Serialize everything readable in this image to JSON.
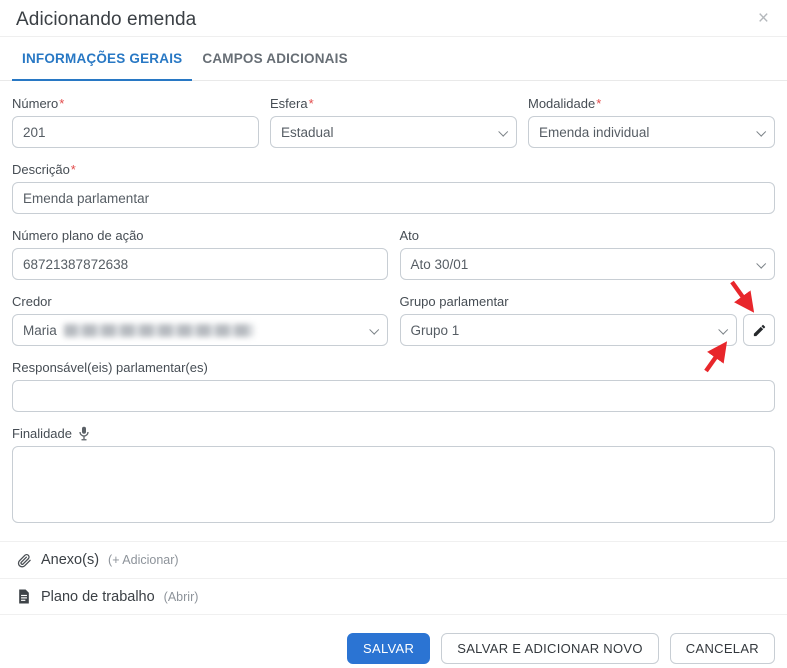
{
  "modal": {
    "title": "Adicionando emenda",
    "close_icon": "×"
  },
  "tabs": [
    {
      "label": "INFORMAÇÕES GERAIS",
      "active": true
    },
    {
      "label": "CAMPOS ADICIONAIS",
      "active": false
    }
  ],
  "form": {
    "required_mark": "*",
    "numero": {
      "label": "Número",
      "required": true,
      "value": "201"
    },
    "esfera": {
      "label": "Esfera",
      "required": true,
      "value": "Estadual"
    },
    "modalidade": {
      "label": "Modalidade",
      "required": true,
      "value": "Emenda individual"
    },
    "descricao": {
      "label": "Descrição",
      "required": true,
      "value": "Emenda parlamentar"
    },
    "numero_plano_acao": {
      "label": "Número plano de ação",
      "value": "68721387872638"
    },
    "ato": {
      "label": "Ato",
      "value": "Ato 30/01"
    },
    "credor": {
      "label": "Credor",
      "value": "Maria",
      "redacted": true
    },
    "grupo_parlamentar": {
      "label": "Grupo parlamentar",
      "value": "Grupo 1"
    },
    "responsavel": {
      "label": "Responsável(eis) parlamentar(es)",
      "value": ""
    },
    "finalidade": {
      "label": "Finalidade",
      "value": ""
    }
  },
  "sections": {
    "anexos": {
      "label": "Anexo(s)",
      "action": "(+ Adicionar)"
    },
    "plano_trabalho": {
      "label": "Plano de trabalho",
      "action": "(Abrir)"
    }
  },
  "footer": {
    "salvar": "SALVAR",
    "salvar_adicionar_novo": "SALVAR E ADICIONAR NOVO",
    "cancelar": "CANCELAR"
  },
  "icons": {
    "close": "close-x",
    "chevron": "chevron-down",
    "microphone": "mic",
    "paperclip": "paperclip",
    "document": "file-text",
    "pencil": "edit-pencil",
    "annotations": "red-arrows"
  },
  "colors": {
    "tab_active_blue": "#2878c4",
    "primary_button_blue": "#2b74d3",
    "required_red": "#e24a4a",
    "annotation_arrow_red": "#e8262b",
    "border_gray": "#c8ced4"
  }
}
